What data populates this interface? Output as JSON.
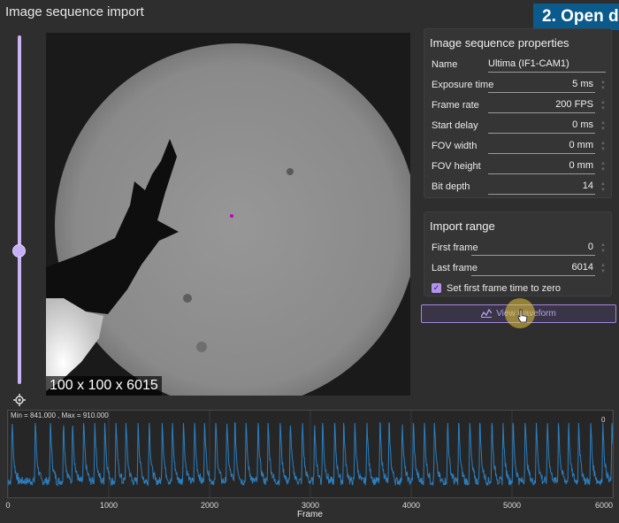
{
  "window": {
    "title": "Image sequence import"
  },
  "overlay_banner": "2. Open d",
  "viewer": {
    "dimensions": "100 x 100 x 6015"
  },
  "properties": {
    "title": "Image sequence properties",
    "rows": [
      {
        "label": "Name",
        "value": "Ultima (IF1-CAM1)"
      },
      {
        "label": "Exposure time",
        "value": "5 ms"
      },
      {
        "label": "Frame rate",
        "value": "200 FPS"
      },
      {
        "label": "Start delay",
        "value": "0 ms"
      },
      {
        "label": "FOV width",
        "value": "0 mm"
      },
      {
        "label": "FOV height",
        "value": "0 mm"
      },
      {
        "label": "Bit depth",
        "value": "14"
      }
    ]
  },
  "import_range": {
    "title": "Import range",
    "rows": [
      {
        "label": "First frame",
        "value": "0"
      },
      {
        "label": "Last frame",
        "value": "6014"
      }
    ],
    "checkbox_label": "Set first frame time to zero",
    "checkbox_checked": true
  },
  "view_waveform_button": "View waveform",
  "icons": [
    "locate-icon",
    "waveform-icon",
    "checkmark-icon",
    "hand-cursor-icon"
  ],
  "colors": {
    "accent": "#b393ee",
    "waveform": "#2b7fc0",
    "banner": "#0a5a8c"
  },
  "chart_data": {
    "type": "line",
    "annotation": "Min = 841.000 , Max = 910.000",
    "right_label": "0",
    "xlabel": "Frame",
    "xlim": [
      0,
      6000
    ],
    "ylim": [
      841,
      910
    ],
    "x_ticks": [
      "0",
      "1000",
      "2000",
      "3000",
      "4000",
      "5000",
      "6000"
    ],
    "series": [
      {
        "peak_frames": [
          40,
          270,
          420,
          550,
          640,
          750,
          860,
          960,
          1070,
          1170,
          1290,
          1400,
          1530,
          1630,
          1740,
          1850,
          1950,
          2060,
          2170,
          2250,
          2360,
          2480,
          2580,
          2700,
          2800,
          2920,
          3040,
          3120,
          3240,
          3330,
          3440,
          3560,
          3690,
          3780,
          3910,
          4020,
          4130,
          4230,
          4360,
          4470,
          4580,
          4680,
          4800,
          4910,
          5010,
          5130,
          5240,
          5350,
          5460,
          5560,
          5660,
          5780,
          5900,
          5990
        ]
      }
    ]
  }
}
